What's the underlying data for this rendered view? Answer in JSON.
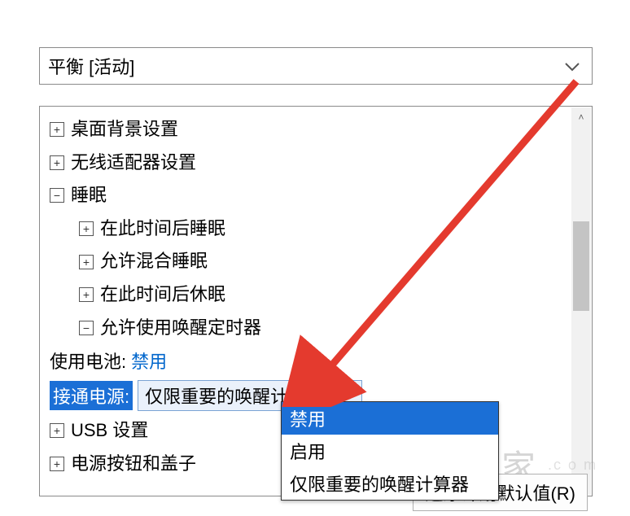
{
  "plan": {
    "selected": "平衡 [活动]"
  },
  "tree": {
    "desktop_bg": "桌面背景设置",
    "wireless": "无线适配器设置",
    "sleep": {
      "label": "睡眠",
      "after_sleep": "在此时间后睡眠",
      "allow_hybrid": "允许混合睡眠",
      "after_hibernate": "在此时间后休眠",
      "wake_timers": {
        "label": "允许使用唤醒定时器",
        "on_battery_label": "使用电池:",
        "on_battery_value": "禁用",
        "plugged_label": "接通电源:",
        "plugged_value": "仅限重要的唤醒计算器"
      }
    },
    "usb": "USB 设置",
    "power_button": "电源按钮和盖子"
  },
  "dropdown": {
    "options": [
      "禁用",
      "启用",
      "仅限重要的唤醒计算器"
    ],
    "highlight_index": 0
  },
  "restore_button": "还原计划默认值(R)",
  "watermark": {
    "text": "装机之家",
    "sub": ".c o m"
  },
  "icons": {
    "chevron_down": "chevron-down-icon",
    "plus": "+",
    "minus": "−",
    "scroll_up": "˄",
    "scroll_down": "˅"
  }
}
